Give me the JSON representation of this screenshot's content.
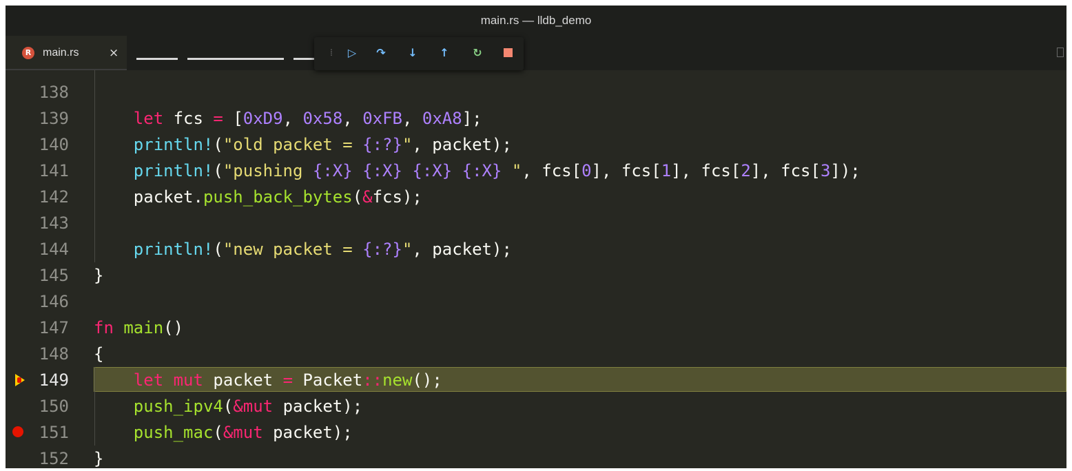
{
  "window": {
    "title": "main.rs — lldb_demo"
  },
  "tab": {
    "icon": "rust-file-icon",
    "label": "main.rs",
    "close": "×"
  },
  "debug_toolbar": {
    "controls": [
      "drag-grip",
      "continue",
      "step-over",
      "step-into",
      "step-out",
      "restart",
      "stop"
    ]
  },
  "editor": {
    "current_line": 149,
    "breakpoints": [
      149,
      151
    ],
    "lines": [
      {
        "num": "138",
        "text": ""
      },
      {
        "num": "139",
        "text": "    let fcs = [0xD9, 0x58, 0xFB, 0xA8];"
      },
      {
        "num": "140",
        "text": "    println!(\"old packet = {:?}\", packet);"
      },
      {
        "num": "141",
        "text": "    println!(\"pushing {:X} {:X} {:X} {:X} \", fcs[0], fcs[1], fcs[2], fcs[3]);"
      },
      {
        "num": "142",
        "text": "    packet.push_back_bytes(&fcs);"
      },
      {
        "num": "143",
        "text": ""
      },
      {
        "num": "144",
        "text": "    println!(\"new packet = {:?}\", packet);"
      },
      {
        "num": "145",
        "text": "}"
      },
      {
        "num": "146",
        "text": ""
      },
      {
        "num": "147",
        "text": "fn main()"
      },
      {
        "num": "148",
        "text": "{"
      },
      {
        "num": "149",
        "text": "    let mut packet = Packet::new();"
      },
      {
        "num": "150",
        "text": "    push_ipv4(&mut packet);"
      },
      {
        "num": "151",
        "text": "    push_mac(&mut packet);"
      },
      {
        "num": "152",
        "text": "}"
      }
    ]
  },
  "colors": {
    "background": "#272822",
    "keyword": "#f92672",
    "function": "#a6e22e",
    "number": "#ae81ff",
    "string": "#e6db74",
    "current_line_highlight": "#535330",
    "breakpoint": "#e51400",
    "debug_blue": "#75beff",
    "debug_green": "#89d185",
    "debug_stop": "#f48771"
  }
}
